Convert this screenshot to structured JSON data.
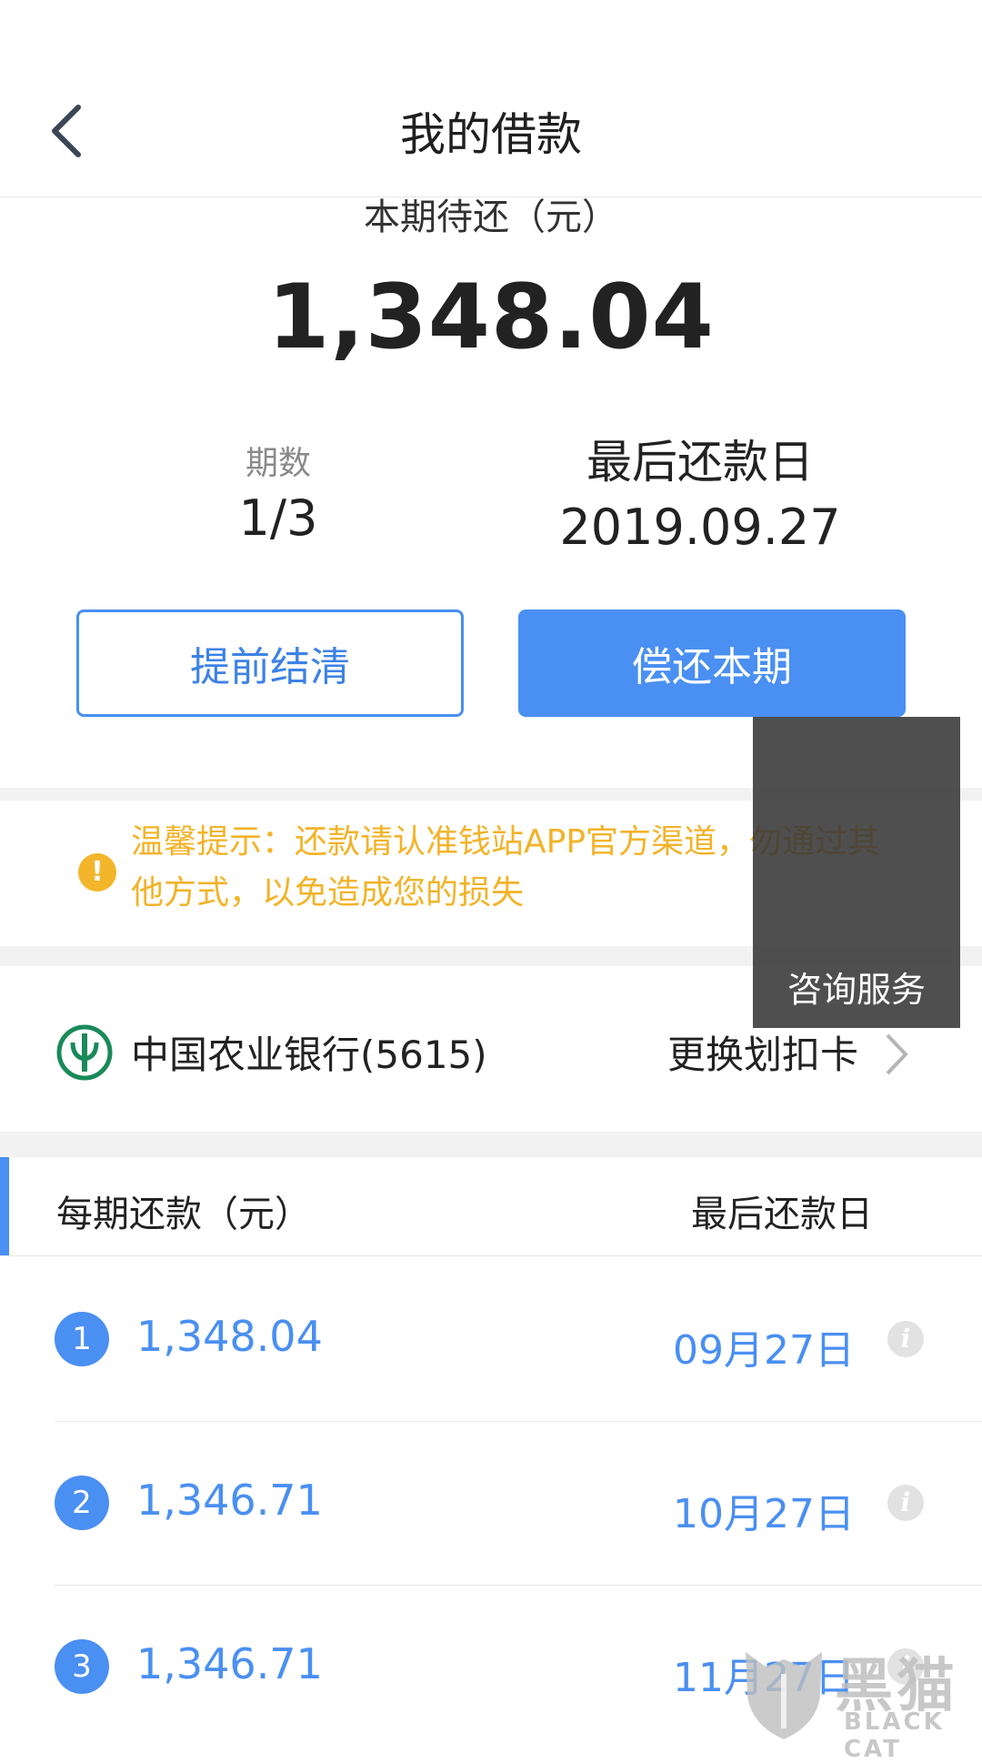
{
  "header": {
    "title": "我的借款"
  },
  "summary": {
    "current_due_label": "本期待还（元）",
    "current_due_amount": "1,348.04",
    "periods_label": "期数",
    "periods_value": "1/3",
    "last_due_label": "最后还款日",
    "last_due_date": "2019.09.27"
  },
  "actions": {
    "settle_early": "提前结清",
    "repay_current": "偿还本期"
  },
  "notice": {
    "text": "温馨提示：还款请认准钱站APP官方渠道，勿通过其他方式，以免造成您的损失"
  },
  "consult": {
    "label": "咨询服务"
  },
  "bank": {
    "name": "中国农业银行(5615)",
    "change_card": "更换划扣卡"
  },
  "schedule": {
    "col_amount": "每期还款（元）",
    "col_date": "最后还款日",
    "rows": [
      {
        "index": "1",
        "amount": "1,348.04",
        "date": "09月27日"
      },
      {
        "index": "2",
        "amount": "1,346.71",
        "date": "10月27日"
      },
      {
        "index": "3",
        "amount": "1,346.71",
        "date": "11月27日"
      }
    ]
  },
  "watermark": {
    "cn": "黑猫",
    "en": "BLACK CAT"
  },
  "colors": {
    "accent": "#4a8ff2",
    "warning": "#f2b329",
    "bank_green": "#1a8a5a"
  }
}
